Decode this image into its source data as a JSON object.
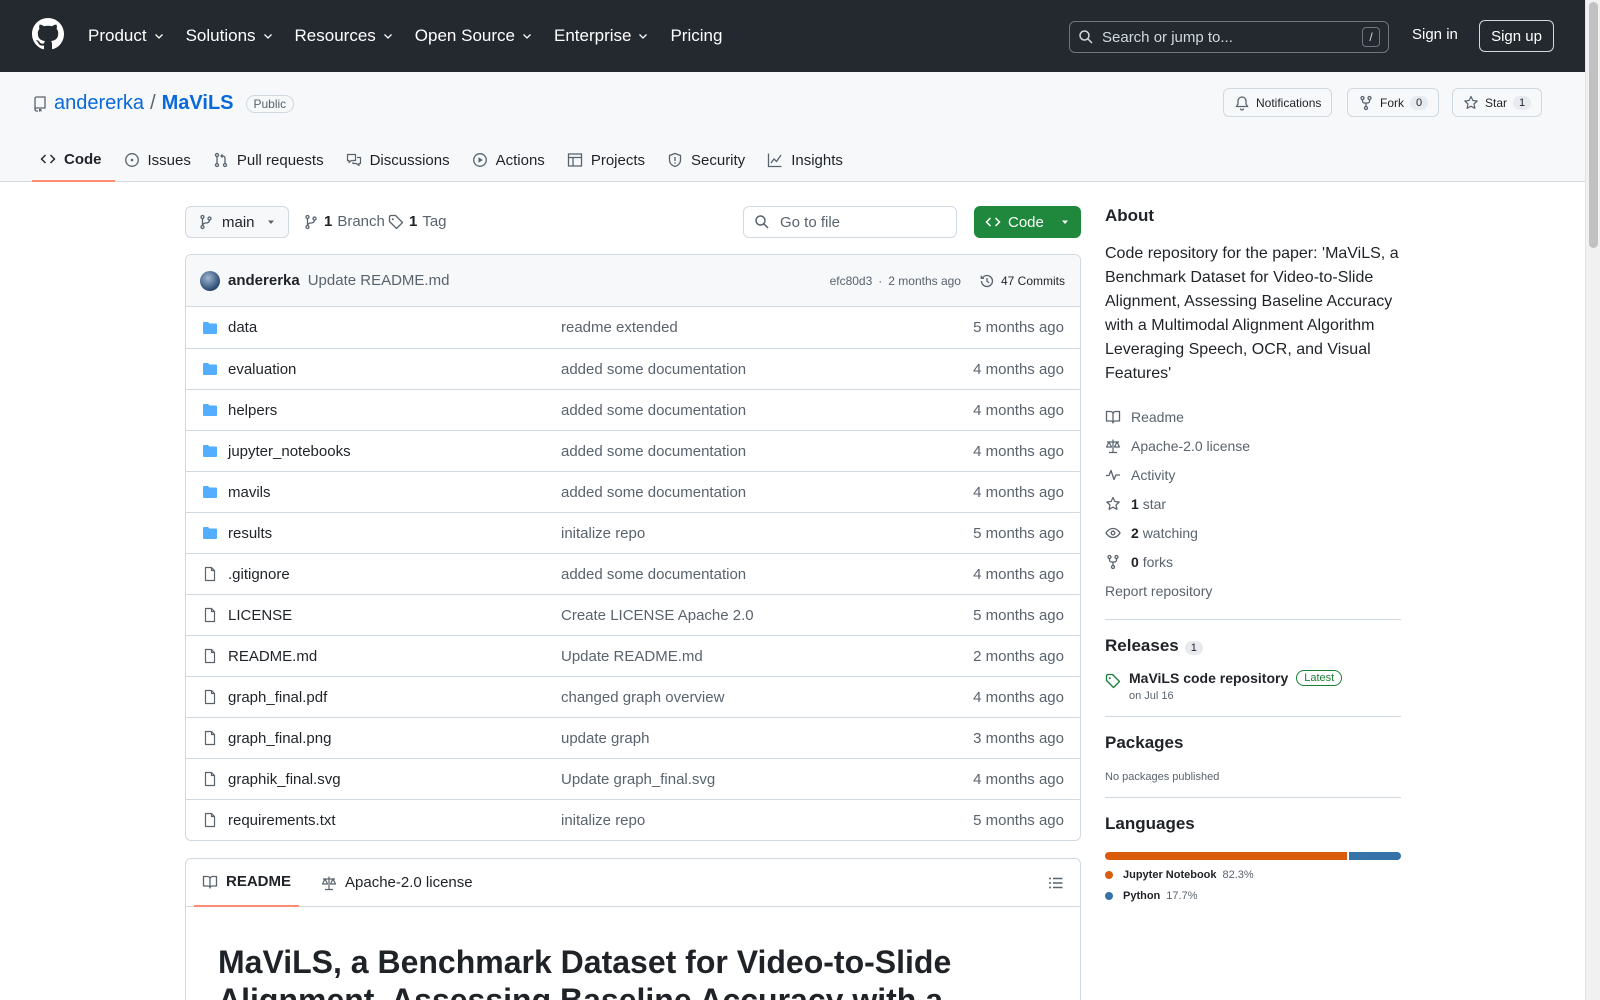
{
  "header": {
    "nav": [
      "Product",
      "Solutions",
      "Resources",
      "Open Source",
      "Enterprise",
      "Pricing"
    ],
    "search_placeholder": "Search or jump to...",
    "search_shortcut": "/",
    "signin": "Sign in",
    "signup": "Sign up"
  },
  "repo": {
    "owner": "andererka",
    "separator": "/",
    "name": "MaViLS",
    "visibility": "Public",
    "notifications_label": "Notifications",
    "fork_label": "Fork",
    "fork_count": "0",
    "star_label": "Star",
    "star_count": "1",
    "tabs": [
      "Code",
      "Issues",
      "Pull requests",
      "Discussions",
      "Actions",
      "Projects",
      "Security",
      "Insights"
    ]
  },
  "toolbar": {
    "branch": "main",
    "branch_count": "1",
    "branch_label": "Branch",
    "tag_count": "1",
    "tag_label": "Tag",
    "goto_placeholder": "Go to file",
    "code_button": "Code"
  },
  "commit": {
    "author": "andererka",
    "message": "Update README.md",
    "hash": "efc80d3",
    "dot": "·",
    "time": "2 months ago",
    "commits_label": "47 Commits"
  },
  "files": [
    {
      "name": "data",
      "type": "dir",
      "message": "readme extended",
      "date": "5 months ago"
    },
    {
      "name": "evaluation",
      "type": "dir",
      "message": "added some documentation",
      "date": "4 months ago"
    },
    {
      "name": "helpers",
      "type": "dir",
      "message": "added some documentation",
      "date": "4 months ago"
    },
    {
      "name": "jupyter_notebooks",
      "type": "dir",
      "message": "added some documentation",
      "date": "4 months ago"
    },
    {
      "name": "mavils",
      "type": "dir",
      "message": "added some documentation",
      "date": "4 months ago"
    },
    {
      "name": "results",
      "type": "dir",
      "message": "initalize repo",
      "date": "5 months ago"
    },
    {
      "name": ".gitignore",
      "type": "file",
      "message": "added some documentation",
      "date": "4 months ago"
    },
    {
      "name": "LICENSE",
      "type": "file",
      "message": "Create LICENSE Apache 2.0",
      "date": "5 months ago"
    },
    {
      "name": "README.md",
      "type": "file",
      "message": "Update README.md",
      "date": "2 months ago"
    },
    {
      "name": "graph_final.pdf",
      "type": "file",
      "message": "changed graph overview",
      "date": "4 months ago"
    },
    {
      "name": "graph_final.png",
      "type": "file",
      "message": "update graph",
      "date": "3 months ago"
    },
    {
      "name": "graphik_final.svg",
      "type": "file",
      "message": "Update graph_final.svg",
      "date": "4 months ago"
    },
    {
      "name": "requirements.txt",
      "type": "file",
      "message": "initalize repo",
      "date": "5 months ago"
    }
  ],
  "readme": {
    "tab_readme": "README",
    "tab_license": "Apache-2.0 license",
    "heading": "MaViLS, a Benchmark Dataset for Video-to-Slide Alignment, Assessing Baseline Accuracy with a"
  },
  "about": {
    "title": "About",
    "description": "Code repository for the paper: 'MaViLS, a Benchmark Dataset for Video-to-Slide Alignment, Assessing Baseline Accuracy with a Multimodal Alignment Algorithm Leveraging Speech, OCR, and Visual Features'",
    "readme": "Readme",
    "license": "Apache-2.0 license",
    "activity": "Activity",
    "stars_count": "1",
    "stars_label": "star",
    "watching_count": "2",
    "watching_label": "watching",
    "forks_count": "0",
    "forks_label": "forks",
    "report": "Report repository"
  },
  "releases": {
    "title": "Releases",
    "count": "1",
    "name": "MaViLS code repository",
    "badge": "Latest",
    "date": "on Jul 16"
  },
  "packages": {
    "title": "Packages",
    "note": "No packages published"
  },
  "languages": {
    "title": "Languages",
    "items": [
      {
        "name": "Jupyter Notebook",
        "percent": "82.3%",
        "fraction": 0.823,
        "color": "#DA5B0B"
      },
      {
        "name": "Python",
        "percent": "17.7%",
        "fraction": 0.177,
        "color": "#3572A5"
      }
    ]
  }
}
